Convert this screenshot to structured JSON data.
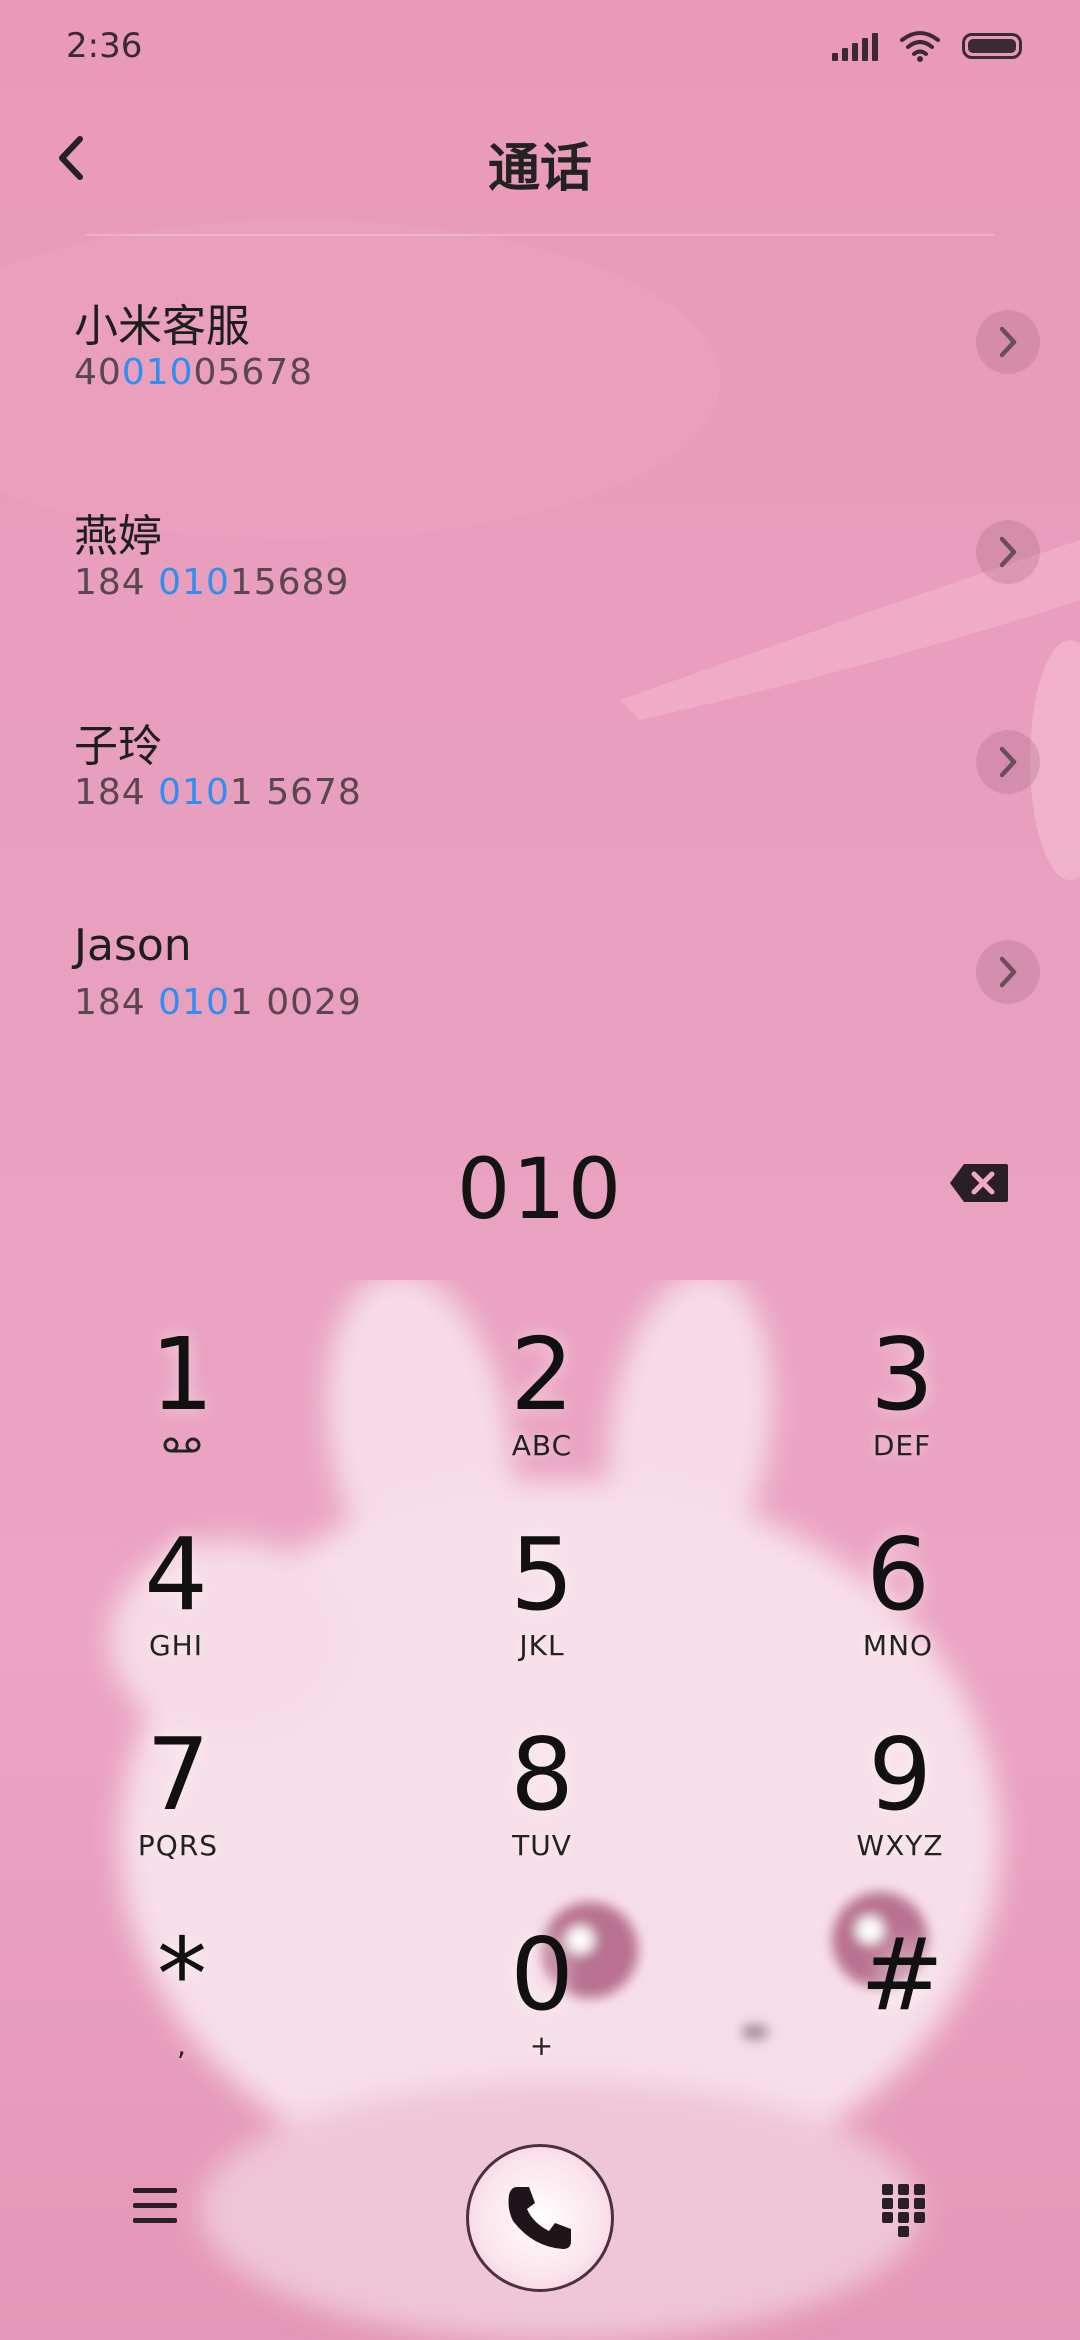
{
  "status_bar": {
    "time": "2:36"
  },
  "header": {
    "title": "通话"
  },
  "results": [
    {
      "name": "小米客服",
      "number_pre": "40",
      "number_match": "010",
      "number_post": "05678"
    },
    {
      "name": "燕婷",
      "number_pre": "184 ",
      "number_match": "010",
      "number_post": "15689"
    },
    {
      "name": "子玲",
      "number_pre": "184 ",
      "number_match": "010",
      "number_post": "1 5678"
    },
    {
      "name": "Jason",
      "number_pre": "184 ",
      "number_match": "010",
      "number_post": "1 0029"
    }
  ],
  "dialer": {
    "input": "010",
    "keys": [
      {
        "digit": "1",
        "letters": ""
      },
      {
        "digit": "2",
        "letters": "ABC"
      },
      {
        "digit": "3",
        "letters": "DEF"
      },
      {
        "digit": "4",
        "letters": "GHI"
      },
      {
        "digit": "5",
        "letters": "JKL"
      },
      {
        "digit": "6",
        "letters": "MNO"
      },
      {
        "digit": "7",
        "letters": "PQRS"
      },
      {
        "digit": "8",
        "letters": "TUV"
      },
      {
        "digit": "9",
        "letters": "WXYZ"
      },
      {
        "digit": "*",
        "letters": ","
      },
      {
        "digit": "0",
        "letters": "+"
      },
      {
        "digit": "#",
        "letters": ""
      }
    ]
  },
  "icons": {
    "back": "chevron-left-icon",
    "detail": "chevron-right-icon",
    "backspace": "backspace-icon",
    "voicemail": "voicemail-icon",
    "menu": "menu-icon",
    "call": "phone-icon",
    "keypad_toggle": "dialpad-icon"
  },
  "colors": {
    "match_highlight": "#2f8ff0",
    "background": "#e99ab8"
  }
}
